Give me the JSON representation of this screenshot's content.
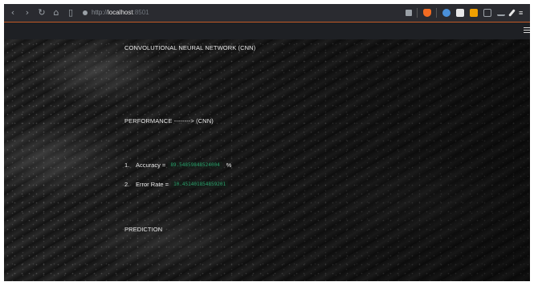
{
  "browser": {
    "url_scheme": "http://",
    "url_host": "localhost",
    "url_port": ":8501",
    "nav_icons": [
      "back-icon",
      "forward-icon",
      "reload-icon",
      "home-icon",
      "bookmark-icon"
    ],
    "ext_colors": [
      "#9aa0a6",
      "#f26b21",
      "#4a90d9",
      "#e8e8e8",
      "#f0a000",
      "#9aa0a6",
      "#9aa0a6",
      "#e8e8e8"
    ]
  },
  "page": {
    "title": "CONVOLUTIONAL NEURAL NETWORK (CNN)",
    "performance_label": "PERFORMANCE --------> (CNN)",
    "metrics": [
      {
        "index": "1.",
        "label": "Accuracy =",
        "value": "89.54859848524004",
        "unit": "%"
      },
      {
        "index": "2.",
        "label": "Error Rate =",
        "value": "10.451401854859201",
        "unit": ""
      }
    ],
    "prediction_label": "PREDICTION"
  },
  "colors": {
    "metric_value": "#2a9d6a",
    "browser_accent": "#c45a26"
  }
}
